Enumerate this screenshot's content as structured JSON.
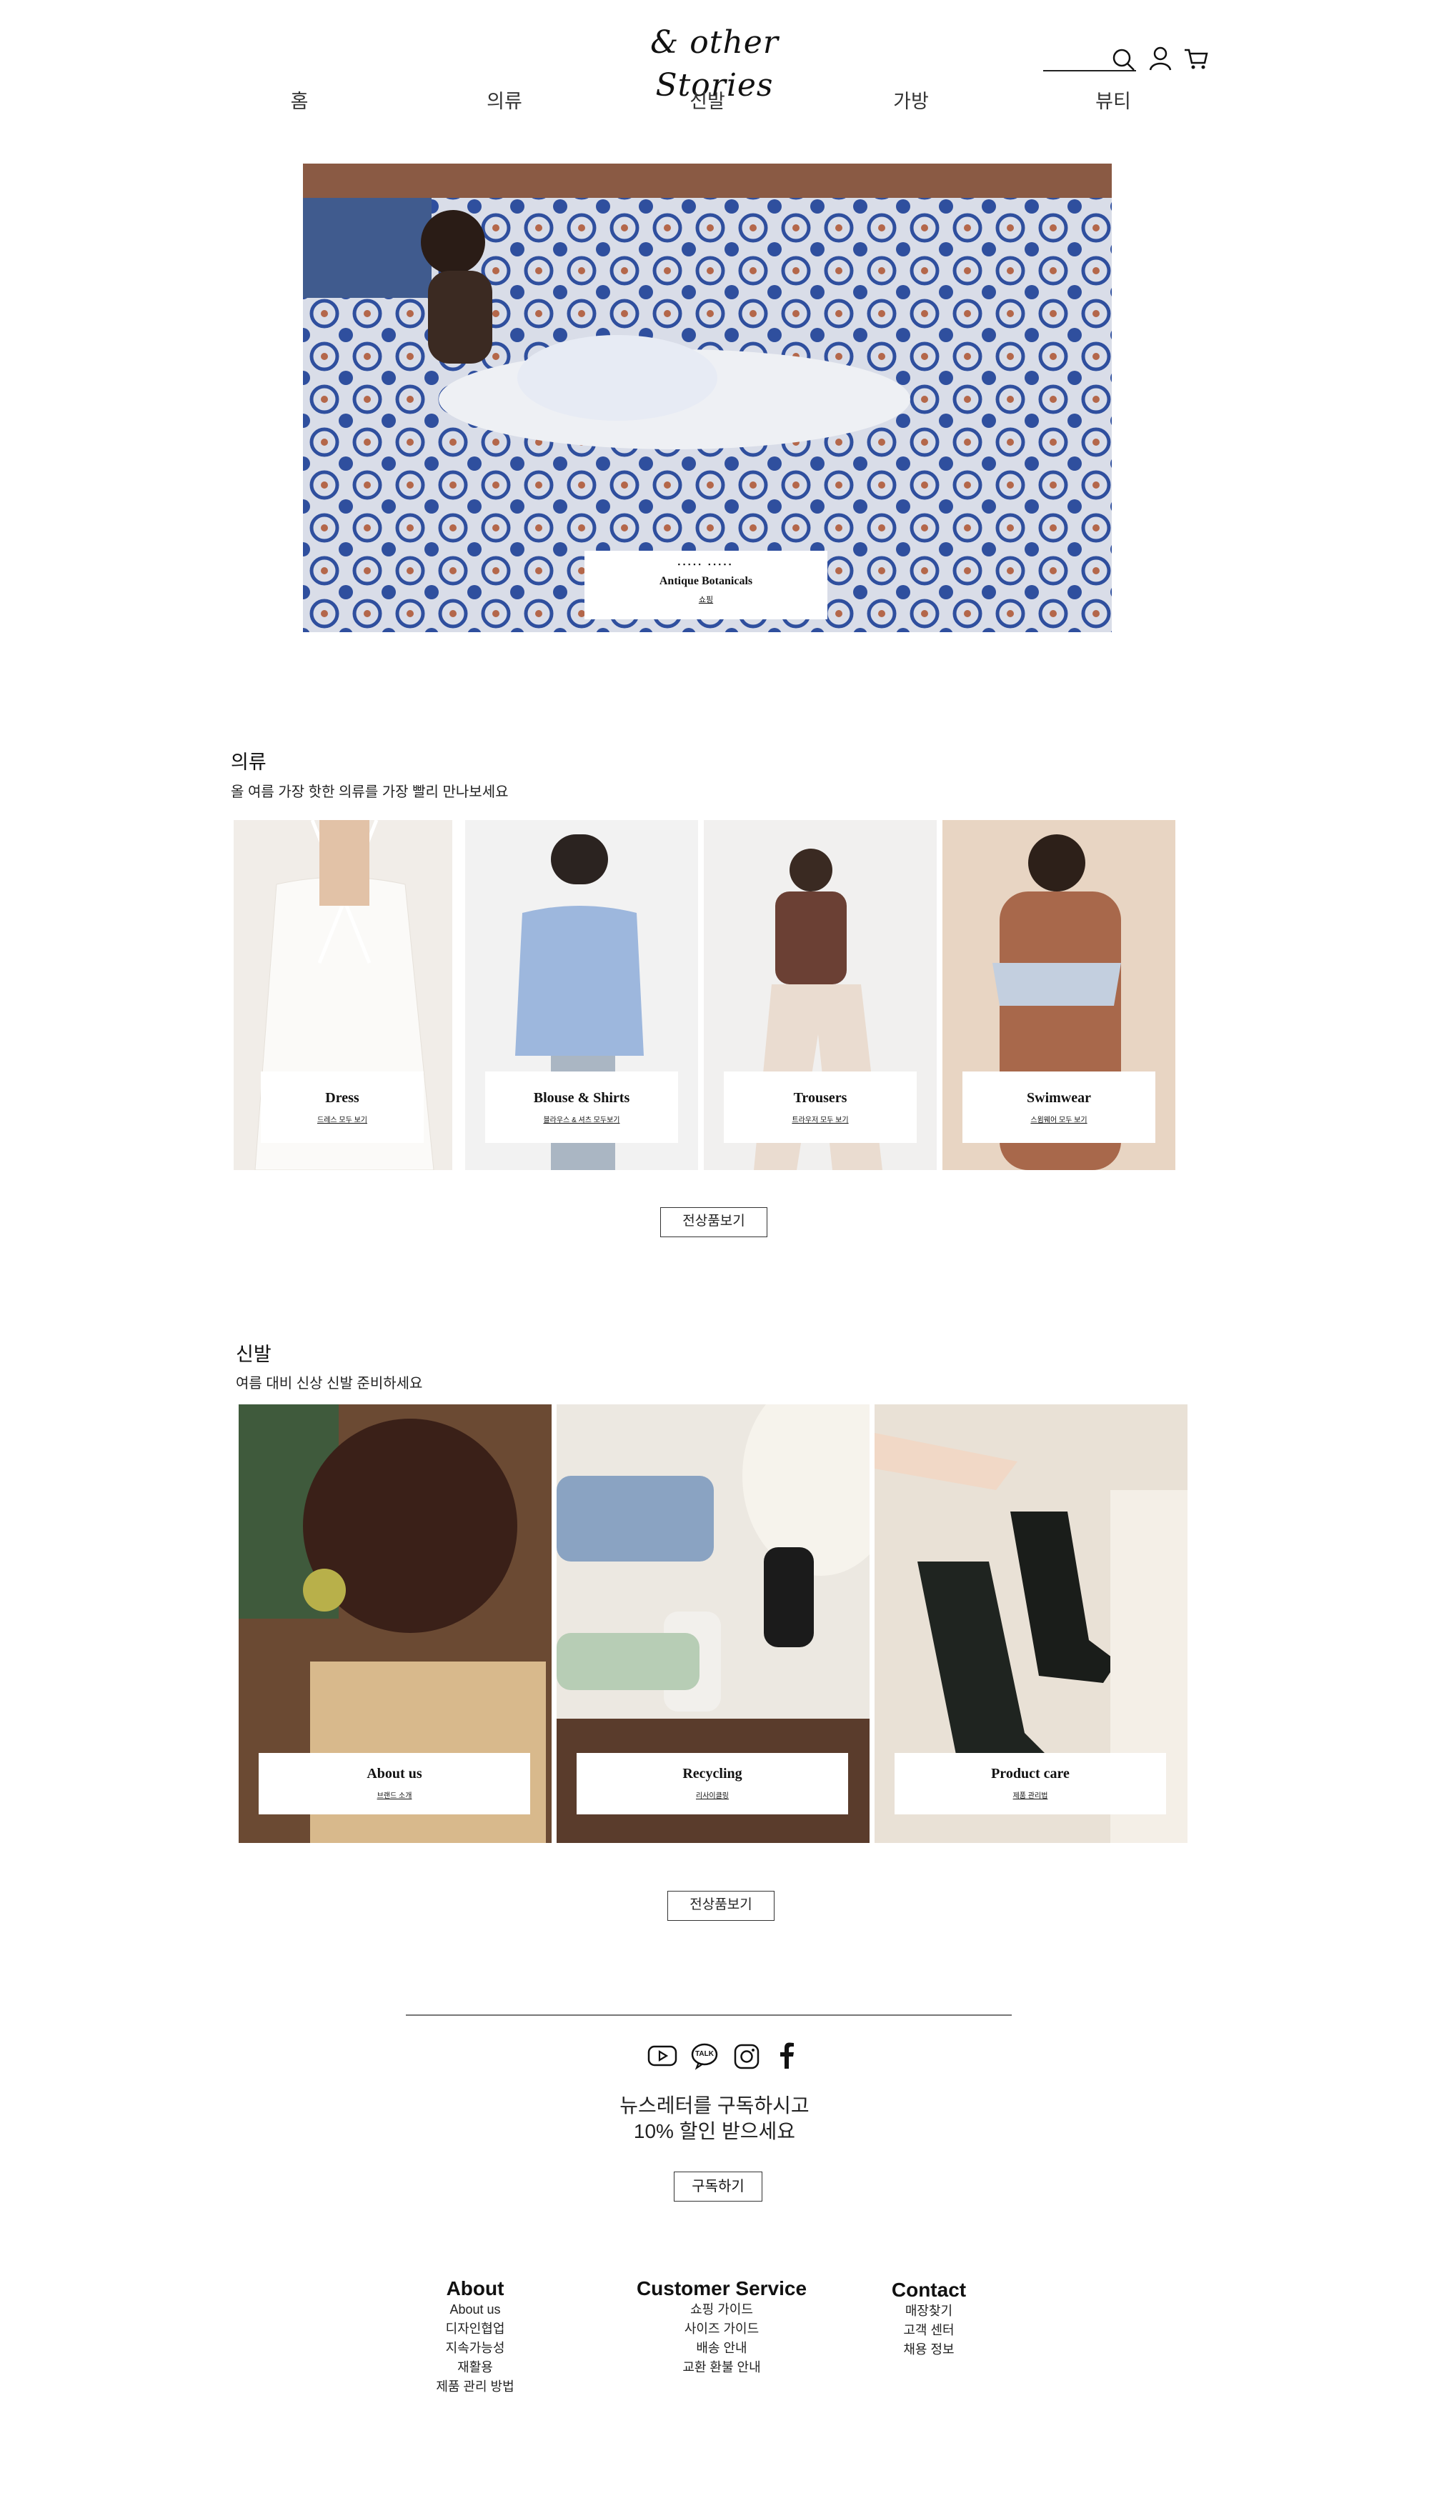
{
  "brand": {
    "logo": "& other Stories"
  },
  "header": {
    "search_placeholder": "",
    "icons": [
      "search-icon",
      "account-icon",
      "cart-icon"
    ]
  },
  "nav": [
    {
      "label": "홈"
    },
    {
      "label": "의류"
    },
    {
      "label": "신발"
    },
    {
      "label": "가방"
    },
    {
      "label": "뷰티"
    }
  ],
  "hero": {
    "kicker": "▪▪▪▪▪ ▪▪▪▪▪",
    "title": "Antique Botanicals",
    "link": "쇼핑"
  },
  "clothing": {
    "title": "의류",
    "subtitle": "올 여름 가장 핫한 의류를 가장 빨리 만나보세요",
    "tiles": [
      {
        "title": "Dress",
        "link": "드레스 모두 보기"
      },
      {
        "title": "Blouse & Shirts",
        "link": "블라우스 & 셔츠 모두보기"
      },
      {
        "title": "Trousers",
        "link": "트라우저 모두 보기"
      },
      {
        "title": "Swimwear",
        "link": "스윔웨어 모두 보기"
      }
    ],
    "view_all": "전상품보기"
  },
  "shoes": {
    "title": "신발",
    "subtitle": "여름 대비 신상 신발 준비하세요",
    "tiles": [
      {
        "title": "About us",
        "link": "브랜드 소개"
      },
      {
        "title": "Recycling",
        "link": "리사이클링"
      },
      {
        "title": "Product care",
        "link": "제품 관리법"
      }
    ],
    "view_all": "전상품보기"
  },
  "footer": {
    "social_icons": [
      "youtube-icon",
      "kakaotalk-icon",
      "instagram-icon",
      "facebook-icon"
    ],
    "kakao_text": "TALK",
    "newsletter_line1": "뉴스레터를 구독하시고",
    "newsletter_line2": "10% 할인 받으세요",
    "subscribe": "구독하기",
    "columns": [
      {
        "heading": "About",
        "links": [
          "About us",
          "디자인협업",
          "지속가능성",
          "재활용",
          "제품 관리 방법"
        ]
      },
      {
        "heading": "Customer Service",
        "links": [
          "쇼핑 가이드",
          "사이즈 가이드",
          "배송 안내",
          "교환 환불 안내"
        ]
      },
      {
        "heading": "Contact",
        "links": [
          "매장찾기",
          "고객 센터",
          "채용 정보"
        ]
      }
    ]
  }
}
